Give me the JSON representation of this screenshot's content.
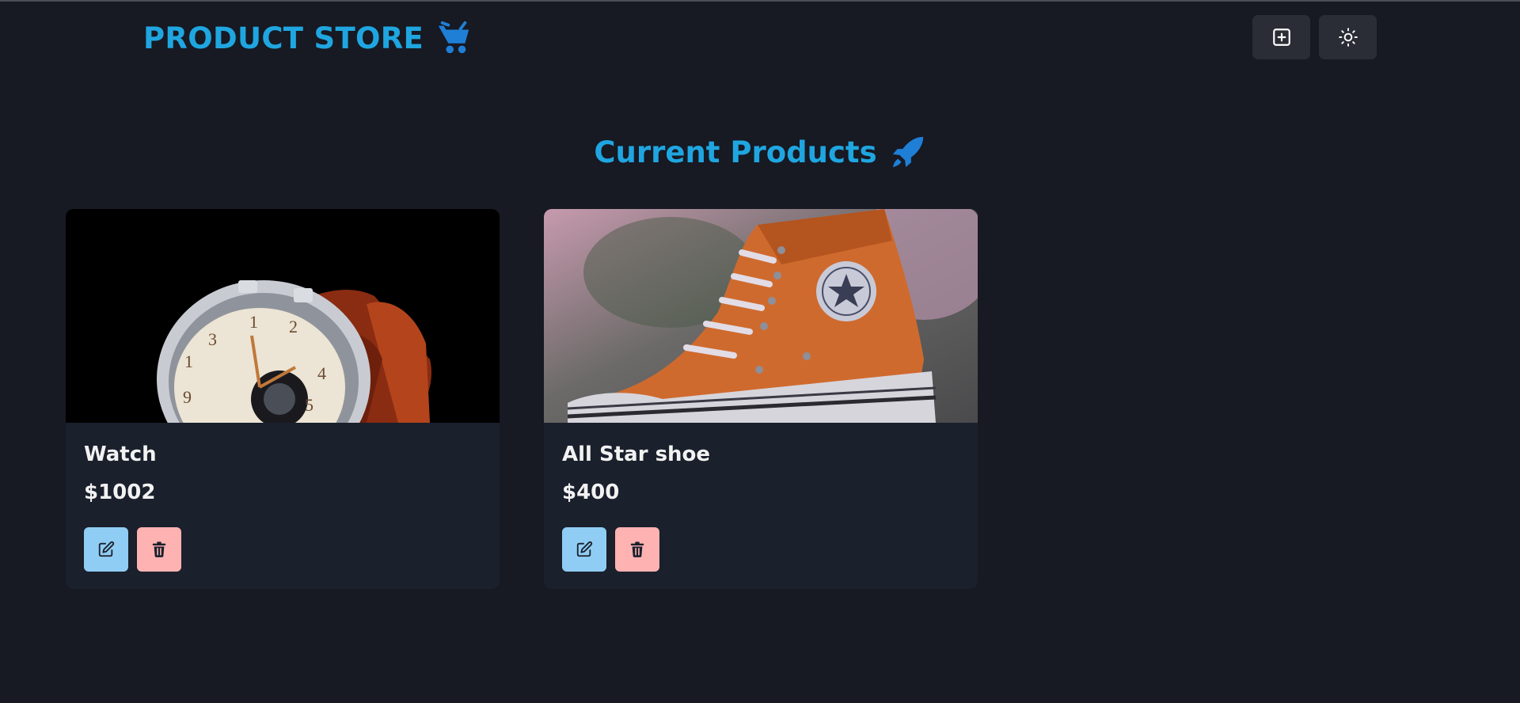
{
  "header": {
    "brand": "PRODUCT STORE",
    "brand_icon": "shopping-cart-icon",
    "create_button_icon": "plus-square-icon",
    "theme_toggle_icon": "sun-icon"
  },
  "main": {
    "title": "Current Products",
    "title_icon": "rocket-icon",
    "products": [
      {
        "name": "Watch",
        "price": "$1002",
        "image": "wristwatch-photo"
      },
      {
        "name": "All Star shoe",
        "price": "$400",
        "image": "orange-sneaker-photo"
      }
    ]
  },
  "colors": {
    "background": "#171923",
    "card": "#1a202c",
    "accent": "#1fa6e0",
    "edit_button": "#90cdf4",
    "delete_button": "#feb2b2"
  }
}
